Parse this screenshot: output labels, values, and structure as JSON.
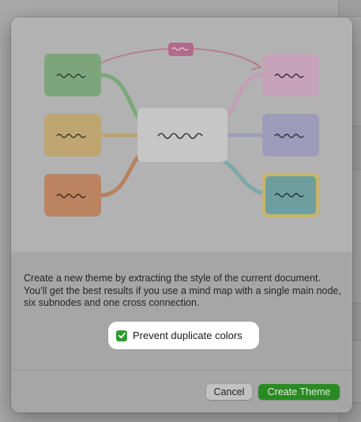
{
  "dialog": {
    "description": "Create a new theme by extracting the style of the current document. You’ll get the best results if you use a mind map with a single main node, six subnodes and one cross connection.",
    "prevent_duplicates": {
      "label": "Prevent duplicate colors",
      "checked": true
    },
    "buttons": {
      "cancel": "Cancel",
      "create": "Create Theme"
    }
  },
  "preview": {
    "main_node_color": "#e8e8e8",
    "cross_connection_color": "#e0408a",
    "left_nodes": [
      {
        "name": "top-left",
        "color": "#6cc36a"
      },
      {
        "name": "middle-left",
        "color": "#e6b84a"
      },
      {
        "name": "bottom-left",
        "color": "#e87b3c"
      }
    ],
    "right_nodes": [
      {
        "name": "top-right",
        "color": "#f0a0cf"
      },
      {
        "name": "middle-right",
        "color": "#9c9cf0"
      },
      {
        "name": "bottom-right",
        "color": "#3ea8aa",
        "selected_border_color": "#f2c542"
      }
    ]
  },
  "colors": {
    "accent_green": "#2f9e2f",
    "create_button": "#2a8a22"
  }
}
